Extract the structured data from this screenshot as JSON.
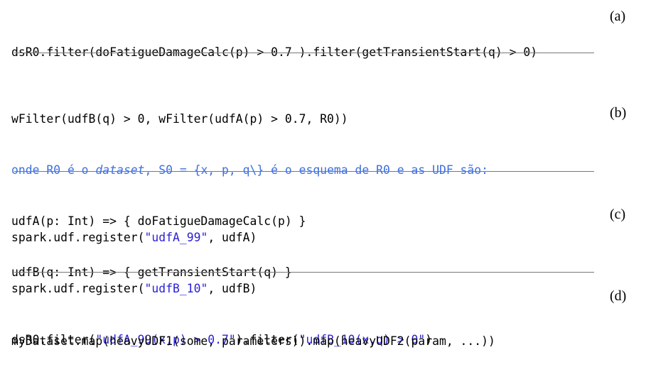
{
  "blocks": {
    "a": {
      "label": "(a)",
      "line1": "dsR0.filter(doFatigueDamageCalc(p) > 0.7 ).filter(getTransientStart(q) > 0)"
    },
    "b": {
      "label": "(b)",
      "line1": "wFilter(udfB(q) > 0, wFilter(udfA(p) > 0.7, R0))",
      "line2_pre": "onde R0 é o ",
      "line2_em": "dataset",
      "line2_post": ", S0 = {x, p, q\\} é o esquema de R0 e as UDF são:",
      "line3": "udfA(p: Int) => { doFatigueDamageCalc(p) }",
      "line4": "udfB(q: Int) => { getTransientStart(q) }"
    },
    "c": {
      "label": "(c)",
      "line1_pre": "spark.udf.register(",
      "line1_str": "\"udfA_99\"",
      "line1_post": ", udfA)",
      "line2_pre": "spark.udf.register(",
      "line2_str": "\"udfB_10\"",
      "line2_post": ", udfB)",
      "line3_pre": "dsR0.filter(",
      "line3_str1": "\"udfA_99(x,p) > 0.7\"",
      "line3_mid": ").filter(",
      "line3_str2": "\"udfB_10(x,q) > 0\"",
      "line3_post": ")"
    },
    "d": {
      "label": "(d)",
      "line1": "myDataset.map(heavyUDF1(some, parameters)).map(heavyUDF2(param, ...))"
    }
  },
  "colors": {
    "string": "#2a1fd6",
    "comment": "#3e6fe0",
    "divider": "#777777"
  }
}
